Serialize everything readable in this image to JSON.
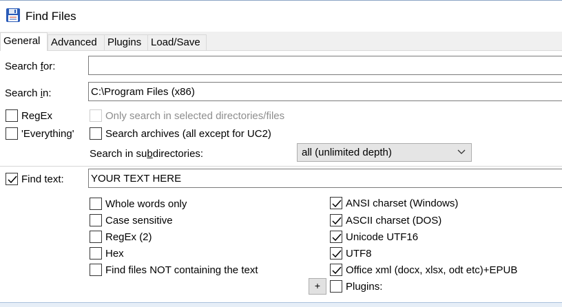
{
  "window": {
    "title": "Find Files",
    "icon": "floppy-disk-icon"
  },
  "tabs": [
    {
      "label": "General",
      "active": true
    },
    {
      "label": "Advanced",
      "active": false
    },
    {
      "label": "Plugins",
      "active": false
    },
    {
      "label": "Load/Save",
      "active": false
    }
  ],
  "general": {
    "search_for": {
      "label_pre": "Search ",
      "label_ul": "f",
      "label_post": "or:",
      "value": ""
    },
    "search_in": {
      "label_pre": "Search ",
      "label_ul": "i",
      "label_post": "n:",
      "value": "C:\\Program Files (x86)"
    },
    "regex_label": "RegEx",
    "everything_label": "'Everything'",
    "only_selected_label": "Only search in selected directories/files",
    "search_archives_label": "Search archives (all except for UC2)",
    "subdir": {
      "label_pre": "Search in su",
      "label_ul": "b",
      "label_post": "directories:",
      "value": "all (unlimited depth)"
    },
    "find_text": {
      "label": "Find text:",
      "checked": true,
      "value": "YOUR TEXT HERE"
    },
    "left_options": [
      {
        "label": "Whole words only",
        "checked": false
      },
      {
        "label": "Case sensitive",
        "checked": false
      },
      {
        "label": "RegEx (2)",
        "checked": false
      },
      {
        "label": "Hex",
        "checked": false
      },
      {
        "label": "Find files NOT containing the text",
        "checked": false
      }
    ],
    "right_options": [
      {
        "label": "ANSI charset (Windows)",
        "checked": true
      },
      {
        "label": "ASCII charset (DOS)",
        "checked": true
      },
      {
        "label": "Unicode UTF16",
        "checked": true
      },
      {
        "label": "UTF8",
        "checked": true
      },
      {
        "label": "Office xml (docx, xlsx, odt etc)+EPUB",
        "checked": true
      },
      {
        "label": "Plugins:",
        "checked": false
      }
    ],
    "plus_button": "+"
  }
}
